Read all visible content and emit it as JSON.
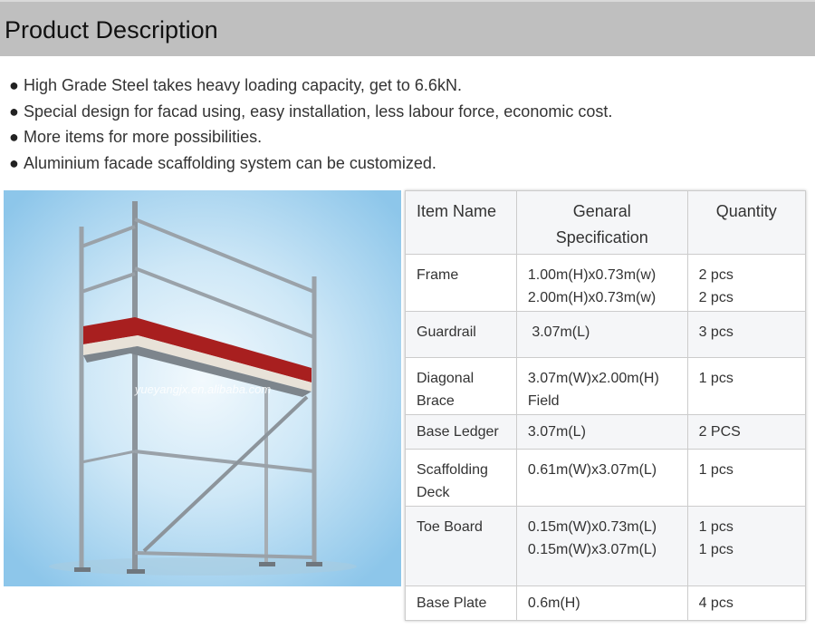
{
  "header": {
    "title": "Product Description"
  },
  "bullets": [
    "High Grade Steel takes heavy loading capacity, get to 6.6kN.",
    "Special design for facad using, easy installation, less labour force, economic cost.",
    "More items for more possibilities.",
    "Aluminium facade scaffolding system can be customized."
  ],
  "bullet_symbol": "●",
  "photo": {
    "watermark": "yueyangjx.en.alibaba.com"
  },
  "table": {
    "headers": {
      "item": "Item Name",
      "spec_line1": "Genaral",
      "spec_line2": "Specification",
      "qty": "Quantity"
    },
    "rows": [
      {
        "name": [
          "Frame"
        ],
        "spec": [
          "1.00m(H)x0.73m(w)",
          "2.00m(H)x0.73m(w)"
        ],
        "qty": [
          "2 pcs",
          "2 pcs"
        ]
      },
      {
        "name": [
          "Guardrail"
        ],
        "spec": [
          " 3.07m(L)"
        ],
        "qty": [
          "3 pcs"
        ]
      },
      {
        "name": [
          "Diagonal",
          "Brace"
        ],
        "spec": [
          "3.07m(W)x2.00m(H)",
          "Field"
        ],
        "qty": [
          "1 pcs"
        ]
      },
      {
        "name": [
          "Base Ledger"
        ],
        "spec": [
          "3.07m(L)"
        ],
        "qty": [
          "2 PCS"
        ]
      },
      {
        "name": [
          "Scaffolding",
          "Deck"
        ],
        "spec": [
          "0.61m(W)x3.07m(L)"
        ],
        "qty": [
          "1 pcs"
        ]
      },
      {
        "name": [
          "Toe Board"
        ],
        "spec": [
          "0.15m(W)x0.73m(L)",
          "0.15m(W)x3.07m(L)"
        ],
        "qty": [
          "1 pcs",
          "1 pcs"
        ]
      },
      {
        "name": [
          "Base Plate"
        ],
        "spec": [
          "0.6m(H)"
        ],
        "qty": [
          "4 pcs"
        ]
      }
    ]
  },
  "colors": {
    "header_bg": "#bfbfbf",
    "photo_bg_light": "#e8f4fb",
    "photo_bg_dark": "#8fc8ec",
    "deck_red": "#a81f1f",
    "table_border": "#cccccc"
  }
}
